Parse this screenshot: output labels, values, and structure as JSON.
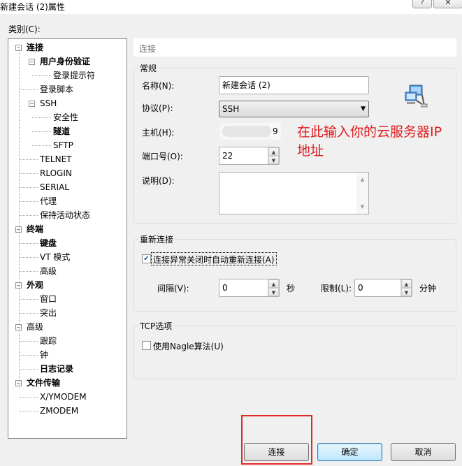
{
  "window": {
    "title": "新建会话 (2)属性",
    "help_glyph": "?",
    "close_glyph": "✕"
  },
  "category_label": "类别(C):",
  "tree": [
    {
      "label": "连接",
      "bold": true,
      "toggle": "−"
    },
    {
      "label": "用户身份验证",
      "bold": true,
      "toggle": "−"
    },
    {
      "label": "登录提示符",
      "bold": false
    },
    {
      "label": "登录脚本",
      "bold": false
    },
    {
      "label": "SSH",
      "bold": false,
      "toggle": "−"
    },
    {
      "label": "安全性",
      "bold": false
    },
    {
      "label": "隧道",
      "bold": true
    },
    {
      "label": "SFTP",
      "bold": false
    },
    {
      "label": "TELNET",
      "bold": false
    },
    {
      "label": "RLOGIN",
      "bold": false
    },
    {
      "label": "SERIAL",
      "bold": false
    },
    {
      "label": "代理",
      "bold": false
    },
    {
      "label": "保持活动状态",
      "bold": false
    },
    {
      "label": "终端",
      "bold": true,
      "toggle": "−"
    },
    {
      "label": "键盘",
      "bold": true
    },
    {
      "label": "VT 模式",
      "bold": false
    },
    {
      "label": "高级",
      "bold": false
    },
    {
      "label": "外观",
      "bold": true,
      "toggle": "−"
    },
    {
      "label": "窗口",
      "bold": false
    },
    {
      "label": "突出",
      "bold": false
    },
    {
      "label": "高级",
      "bold": false,
      "toggle": "−"
    },
    {
      "label": "跟踪",
      "bold": false
    },
    {
      "label": "钟",
      "bold": false
    },
    {
      "label": "日志记录",
      "bold": true
    },
    {
      "label": "文件传输",
      "bold": true,
      "toggle": "−"
    },
    {
      "label": "X/YMODEM",
      "bold": false
    },
    {
      "label": "ZMODEM",
      "bold": false
    }
  ],
  "header": "连接",
  "general": {
    "legend": "常规",
    "name_label": "名称(N):",
    "name_value": "新建会话 (2)",
    "protocol_label": "协议(P):",
    "protocol_value": "SSH",
    "host_label": "主机(H):",
    "host_value": "9",
    "port_label": "端口号(O):",
    "port_value": "22",
    "desc_label": "说明(D):",
    "desc_value": ""
  },
  "annotation": [
    "在此输入你的云服务器IP",
    "地址"
  ],
  "reconnect": {
    "legend": "重新连接",
    "checkbox_label": "连接异常关闭时自动重新连接(A)",
    "checked": true,
    "interval_label": "间隔(V):",
    "interval_value": "0",
    "seconds_unit": "秒",
    "limit_label": "限制(L):",
    "limit_value": "0",
    "minutes_unit": "分钟"
  },
  "tcp": {
    "legend": "TCP选项",
    "nagle_label": "使用Nagle算法(U)",
    "checked": false
  },
  "buttons": {
    "connect": "连接",
    "ok": "确定",
    "cancel": "取消"
  },
  "colors": {
    "annotation": "#e11d1d",
    "highlight_box": "#e32a2a"
  }
}
